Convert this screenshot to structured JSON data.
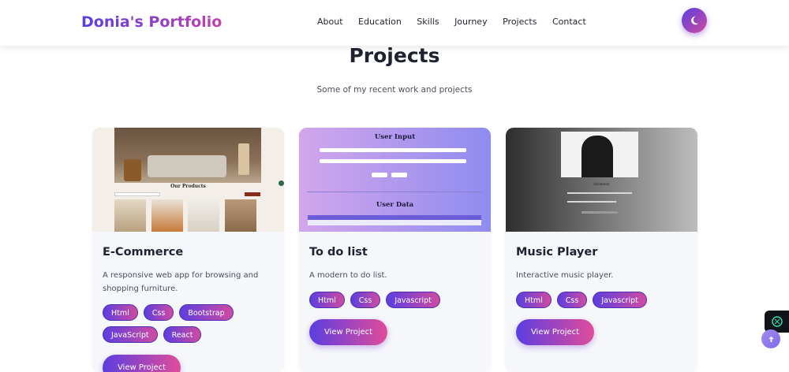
{
  "nav": {
    "brand": "Donia's Portfolio",
    "links": [
      "About",
      "Education",
      "Skills",
      "Journey",
      "Projects",
      "Contact"
    ],
    "theme_icon": "moon-icon"
  },
  "section": {
    "title": "Projects",
    "subtitle": "Some of my recent work and projects"
  },
  "projects": [
    {
      "title": "E-Commerce",
      "description": "A responsive web app for browsing and shopping furniture.",
      "tags": [
        "Html",
        "Css",
        "Bootstrap",
        "JavaScript",
        "React"
      ],
      "button": "View Project",
      "preview": {
        "heading": "Our Products"
      }
    },
    {
      "title": "To do list",
      "description": "A modern to do list.",
      "tags": [
        "Html",
        "Css",
        "Javascript"
      ],
      "button": "View Project",
      "preview": {
        "heading": "User Input",
        "subheading": "User Data"
      }
    },
    {
      "title": "Music Player",
      "description": "Interactive music player.",
      "tags": [
        "Html",
        "Css",
        "Javascript"
      ],
      "button": "View Project",
      "preview": {
        "track": "Uniskens"
      }
    }
  ],
  "floating": {
    "assistant_icon": "chatgpt-icon",
    "scroll_top_icon": "arrow-up-icon"
  },
  "colors": {
    "accent_start": "#5b3ee0",
    "accent_end": "#d04ba0",
    "text": "#1f2330"
  }
}
